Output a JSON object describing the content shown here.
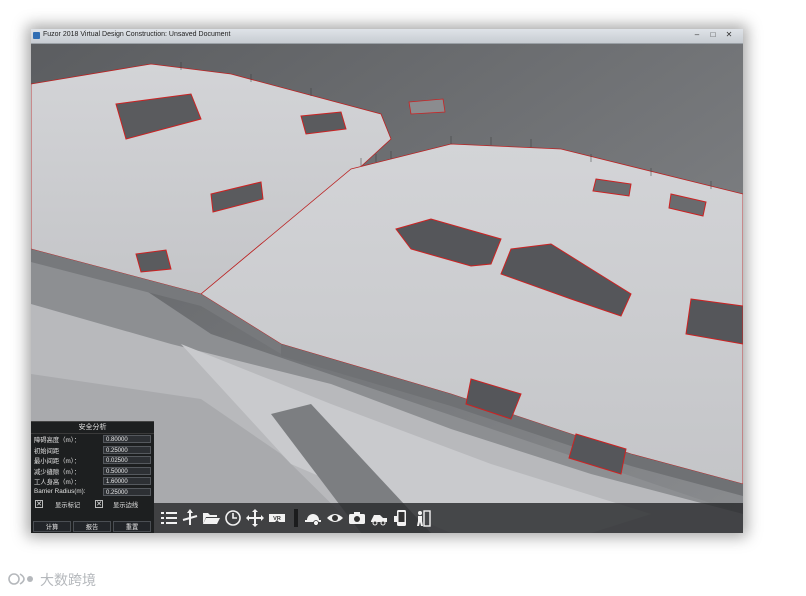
{
  "window": {
    "title": "Fuzor 2018 Virtual Design Construction: Unsaved Document",
    "buttons": [
      "–",
      "□",
      "✕"
    ]
  },
  "safety_panel": {
    "title": "安全分析",
    "rows": [
      {
        "label": "障碍高度（m）：",
        "value": "0.80000"
      },
      {
        "label": "初始间距",
        "value": "0.25000"
      },
      {
        "label": "最小间距（m）：",
        "value": "0.02500"
      },
      {
        "label": "减少缝隙（m）：",
        "value": "0.50000"
      },
      {
        "label": "工人身高（m）：",
        "value": "1.60000"
      },
      {
        "label": "Barrier Radius(m):",
        "value": "0.25000"
      }
    ],
    "checkboxes": [
      {
        "label": "显示标记",
        "mark": "✕"
      },
      {
        "label": "显示边线",
        "mark": "✕"
      }
    ],
    "buttons": [
      "计算",
      "报告",
      "重置"
    ]
  },
  "toolbar": {
    "icons": [
      "list-icon",
      "move-axes-icon",
      "folder-open-icon",
      "clock-icon",
      "pan-arrows-icon",
      "vr-icon",
      "hardhat-icon",
      "eye-icon",
      "camera-icon",
      "vehicle-icon",
      "phone-icon",
      "person-door-icon"
    ],
    "vr_label": "VR"
  },
  "watermark": {
    "text": "大数跨境"
  }
}
